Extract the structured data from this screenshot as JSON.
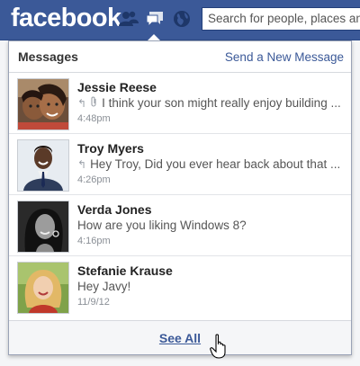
{
  "topbar": {
    "logo": "facebook",
    "search_placeholder": "Search for people, places and things"
  },
  "dropdown": {
    "title": "Messages",
    "send_new": "Send a New Message",
    "see_all": "See All",
    "messages": [
      {
        "name": "Jessie Reese",
        "snippet": "I think your son might really enjoy building ...",
        "time": "4:48pm",
        "replied": true,
        "attachment": true
      },
      {
        "name": "Troy Myers",
        "snippet": "Hey Troy, Did you ever hear back about that ...",
        "time": "4:26pm",
        "replied": true,
        "attachment": false
      },
      {
        "name": "Verda Jones",
        "snippet": "How are you liking Windows 8?",
        "time": "4:16pm",
        "replied": false,
        "attachment": false
      },
      {
        "name": "Stefanie Krause",
        "snippet": "Hey Javy!",
        "time": "11/9/12",
        "replied": false,
        "attachment": false
      }
    ]
  },
  "colors": {
    "brand": "#3b5998",
    "link": "#3b5998"
  }
}
